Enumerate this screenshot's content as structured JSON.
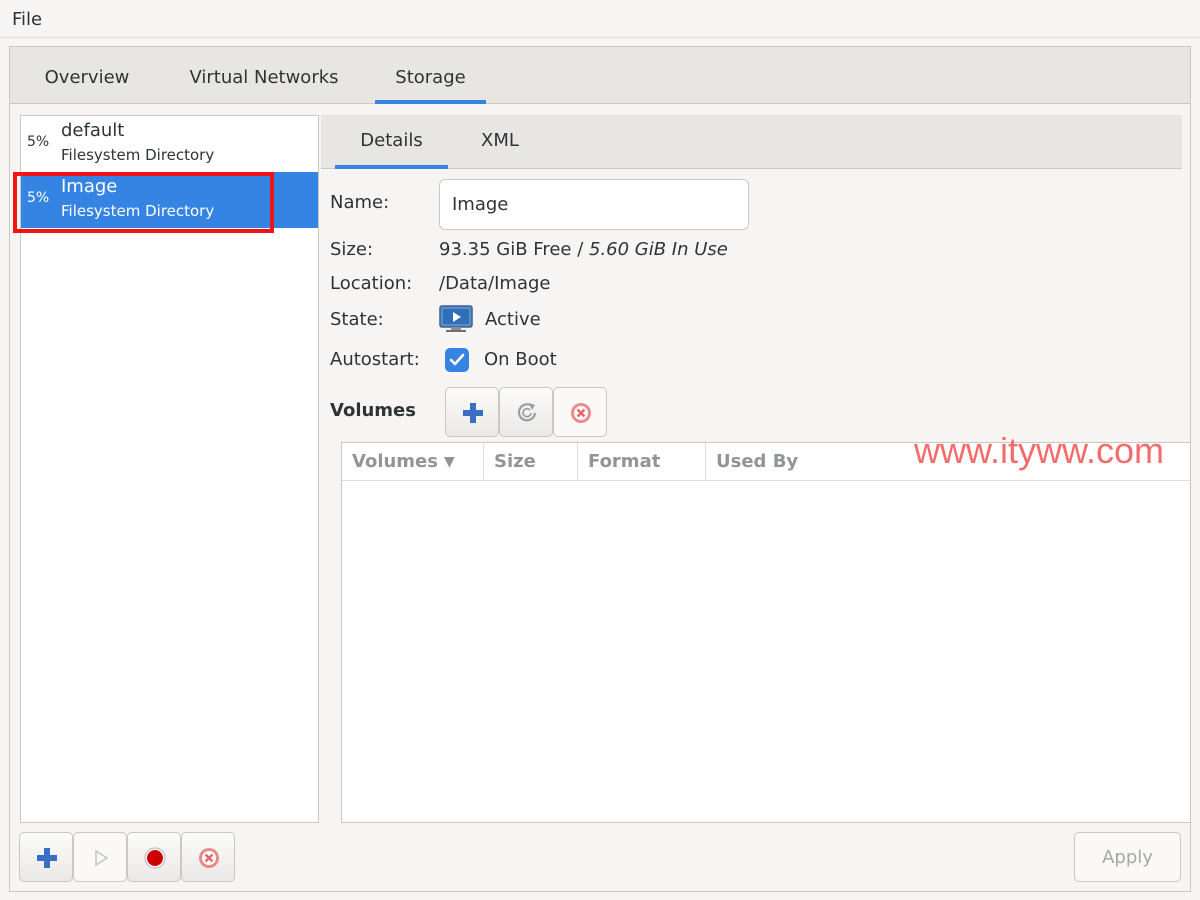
{
  "menubar": {
    "file": "File"
  },
  "top_tabs": [
    {
      "label": "Overview",
      "active": false
    },
    {
      "label": "Virtual Networks",
      "active": false
    },
    {
      "label": "Storage",
      "active": true
    }
  ],
  "pools": [
    {
      "pct": "5%",
      "name": "default",
      "type": "Filesystem Directory",
      "selected": false
    },
    {
      "pct": "5%",
      "name": "Image",
      "type": "Filesystem Directory",
      "selected": true
    }
  ],
  "detail_tabs": [
    {
      "label": "Details",
      "active": true
    },
    {
      "label": "XML",
      "active": false
    }
  ],
  "details": {
    "name_label": "Name:",
    "name_value": "Image",
    "size_label": "Size:",
    "size_free": "93.35 GiB Free",
    "size_sep": " / ",
    "size_in_use": "5.60 GiB In Use",
    "location_label": "Location:",
    "location_value": "/Data/Image",
    "state_label": "State:",
    "state_value": "Active",
    "state_icon": "monitor-play-icon",
    "autostart_label": "Autostart:",
    "autostart_value": "On Boot",
    "autostart_checked": true
  },
  "volumes": {
    "title": "Volumes",
    "toolbar_icons": [
      "plus-icon",
      "refresh-icon",
      "delete-icon"
    ],
    "columns": [
      "Volumes",
      "Size",
      "Format",
      "Used By"
    ],
    "sorted_column": "Volumes",
    "rows": []
  },
  "bottom_toolbar": {
    "icons": [
      "plus-icon",
      "play-icon",
      "stop-icon",
      "delete-icon"
    ]
  },
  "apply_label": "Apply",
  "watermark": "www.ityww.com",
  "colors": {
    "accent": "#3584e4",
    "highlight": "#f01414",
    "stop": "#cc0000",
    "delete": "#e66565"
  }
}
